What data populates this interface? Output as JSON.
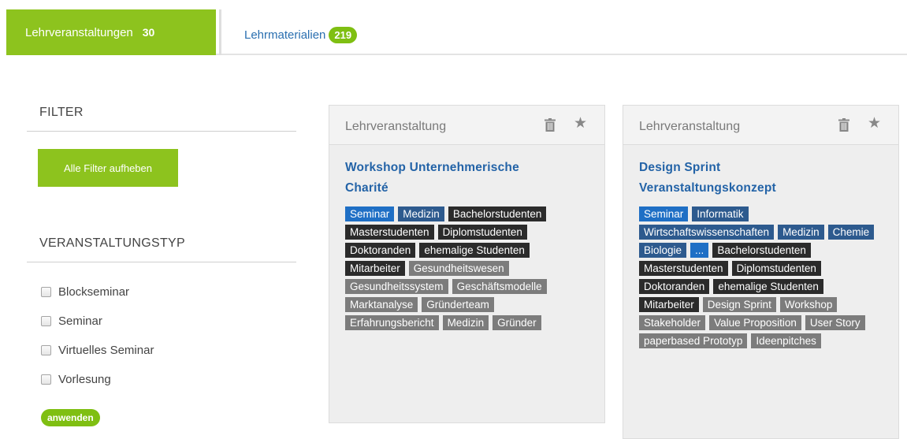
{
  "tabs": {
    "active": {
      "label": "Lehrveranstaltungen",
      "count": "30"
    },
    "inactive": {
      "label": "Lehrmaterialien",
      "count": "219"
    }
  },
  "sidebar": {
    "filter_title": "FILTER",
    "clear_label": "Alle Filter aufheben",
    "type_title": "VERANSTALTUNGSTYP",
    "options": [
      "Blockseminar",
      "Seminar",
      "Virtuelles Seminar",
      "Vorlesung"
    ],
    "apply_label": "anwenden"
  },
  "cards": [
    {
      "type": "Lehrveranstaltung",
      "title_line1": "Workshop Unternehmerische",
      "title_line2": "Charité",
      "tags": [
        {
          "text": "Seminar",
          "kind": "blue1"
        },
        {
          "text": "Medizin",
          "kind": "blue2"
        },
        {
          "text": "Bachelorstudenten",
          "kind": "dark"
        },
        {
          "text": "Masterstudenten",
          "kind": "dark"
        },
        {
          "text": "Diplomstudenten",
          "kind": "dark"
        },
        {
          "text": "Doktoranden",
          "kind": "dark"
        },
        {
          "text": "ehemalige Studenten",
          "kind": "dark"
        },
        {
          "text": "Mitarbeiter",
          "kind": "dark"
        },
        {
          "text": "Gesundheitswesen",
          "kind": "gray"
        },
        {
          "text": "Gesundheitssystem",
          "kind": "gray"
        },
        {
          "text": "Geschäftsmodelle",
          "kind": "gray"
        },
        {
          "text": "Marktanalyse",
          "kind": "gray"
        },
        {
          "text": "Gründerteam",
          "kind": "gray"
        },
        {
          "text": "Erfahrungsbericht",
          "kind": "gray"
        },
        {
          "text": "Medizin",
          "kind": "gray"
        },
        {
          "text": "Gründer",
          "kind": "gray"
        }
      ]
    },
    {
      "type": "Lehrveranstaltung",
      "title_line1": "Design Sprint",
      "title_line2": "Veranstaltungskonzept",
      "tags": [
        {
          "text": "Seminar",
          "kind": "blue1"
        },
        {
          "text": "Informatik",
          "kind": "blue2"
        },
        {
          "text": "Wirtschaftswissenschaften",
          "kind": "blue2"
        },
        {
          "text": "Medizin",
          "kind": "blue2"
        },
        {
          "text": "Chemie",
          "kind": "blue2"
        },
        {
          "text": "Biologie",
          "kind": "blue2"
        },
        {
          "text": "...",
          "kind": "blue1"
        },
        {
          "text": "Bachelorstudenten",
          "kind": "dark"
        },
        {
          "text": "Masterstudenten",
          "kind": "dark"
        },
        {
          "text": "Diplomstudenten",
          "kind": "dark"
        },
        {
          "text": "Doktoranden",
          "kind": "dark"
        },
        {
          "text": "ehemalige Studenten",
          "kind": "dark"
        },
        {
          "text": "Mitarbeiter",
          "kind": "dark"
        },
        {
          "text": "Design Sprint",
          "kind": "gray"
        },
        {
          "text": "Workshop",
          "kind": "gray"
        },
        {
          "text": "Stakeholder",
          "kind": "gray"
        },
        {
          "text": "Value Proposition",
          "kind": "gray"
        },
        {
          "text": "User Story",
          "kind": "gray"
        },
        {
          "text": "paperbased Prototyp",
          "kind": "gray"
        },
        {
          "text": "Ideenpitches",
          "kind": "gray"
        }
      ]
    }
  ],
  "colors": {
    "accent": "#8dc31e",
    "link": "#2363a7",
    "tag_blue": "#1f6fc5",
    "tag_navy": "#2d5a8e",
    "tag_dark": "#2b2b2b",
    "tag_gray": "#7c7c7c"
  }
}
